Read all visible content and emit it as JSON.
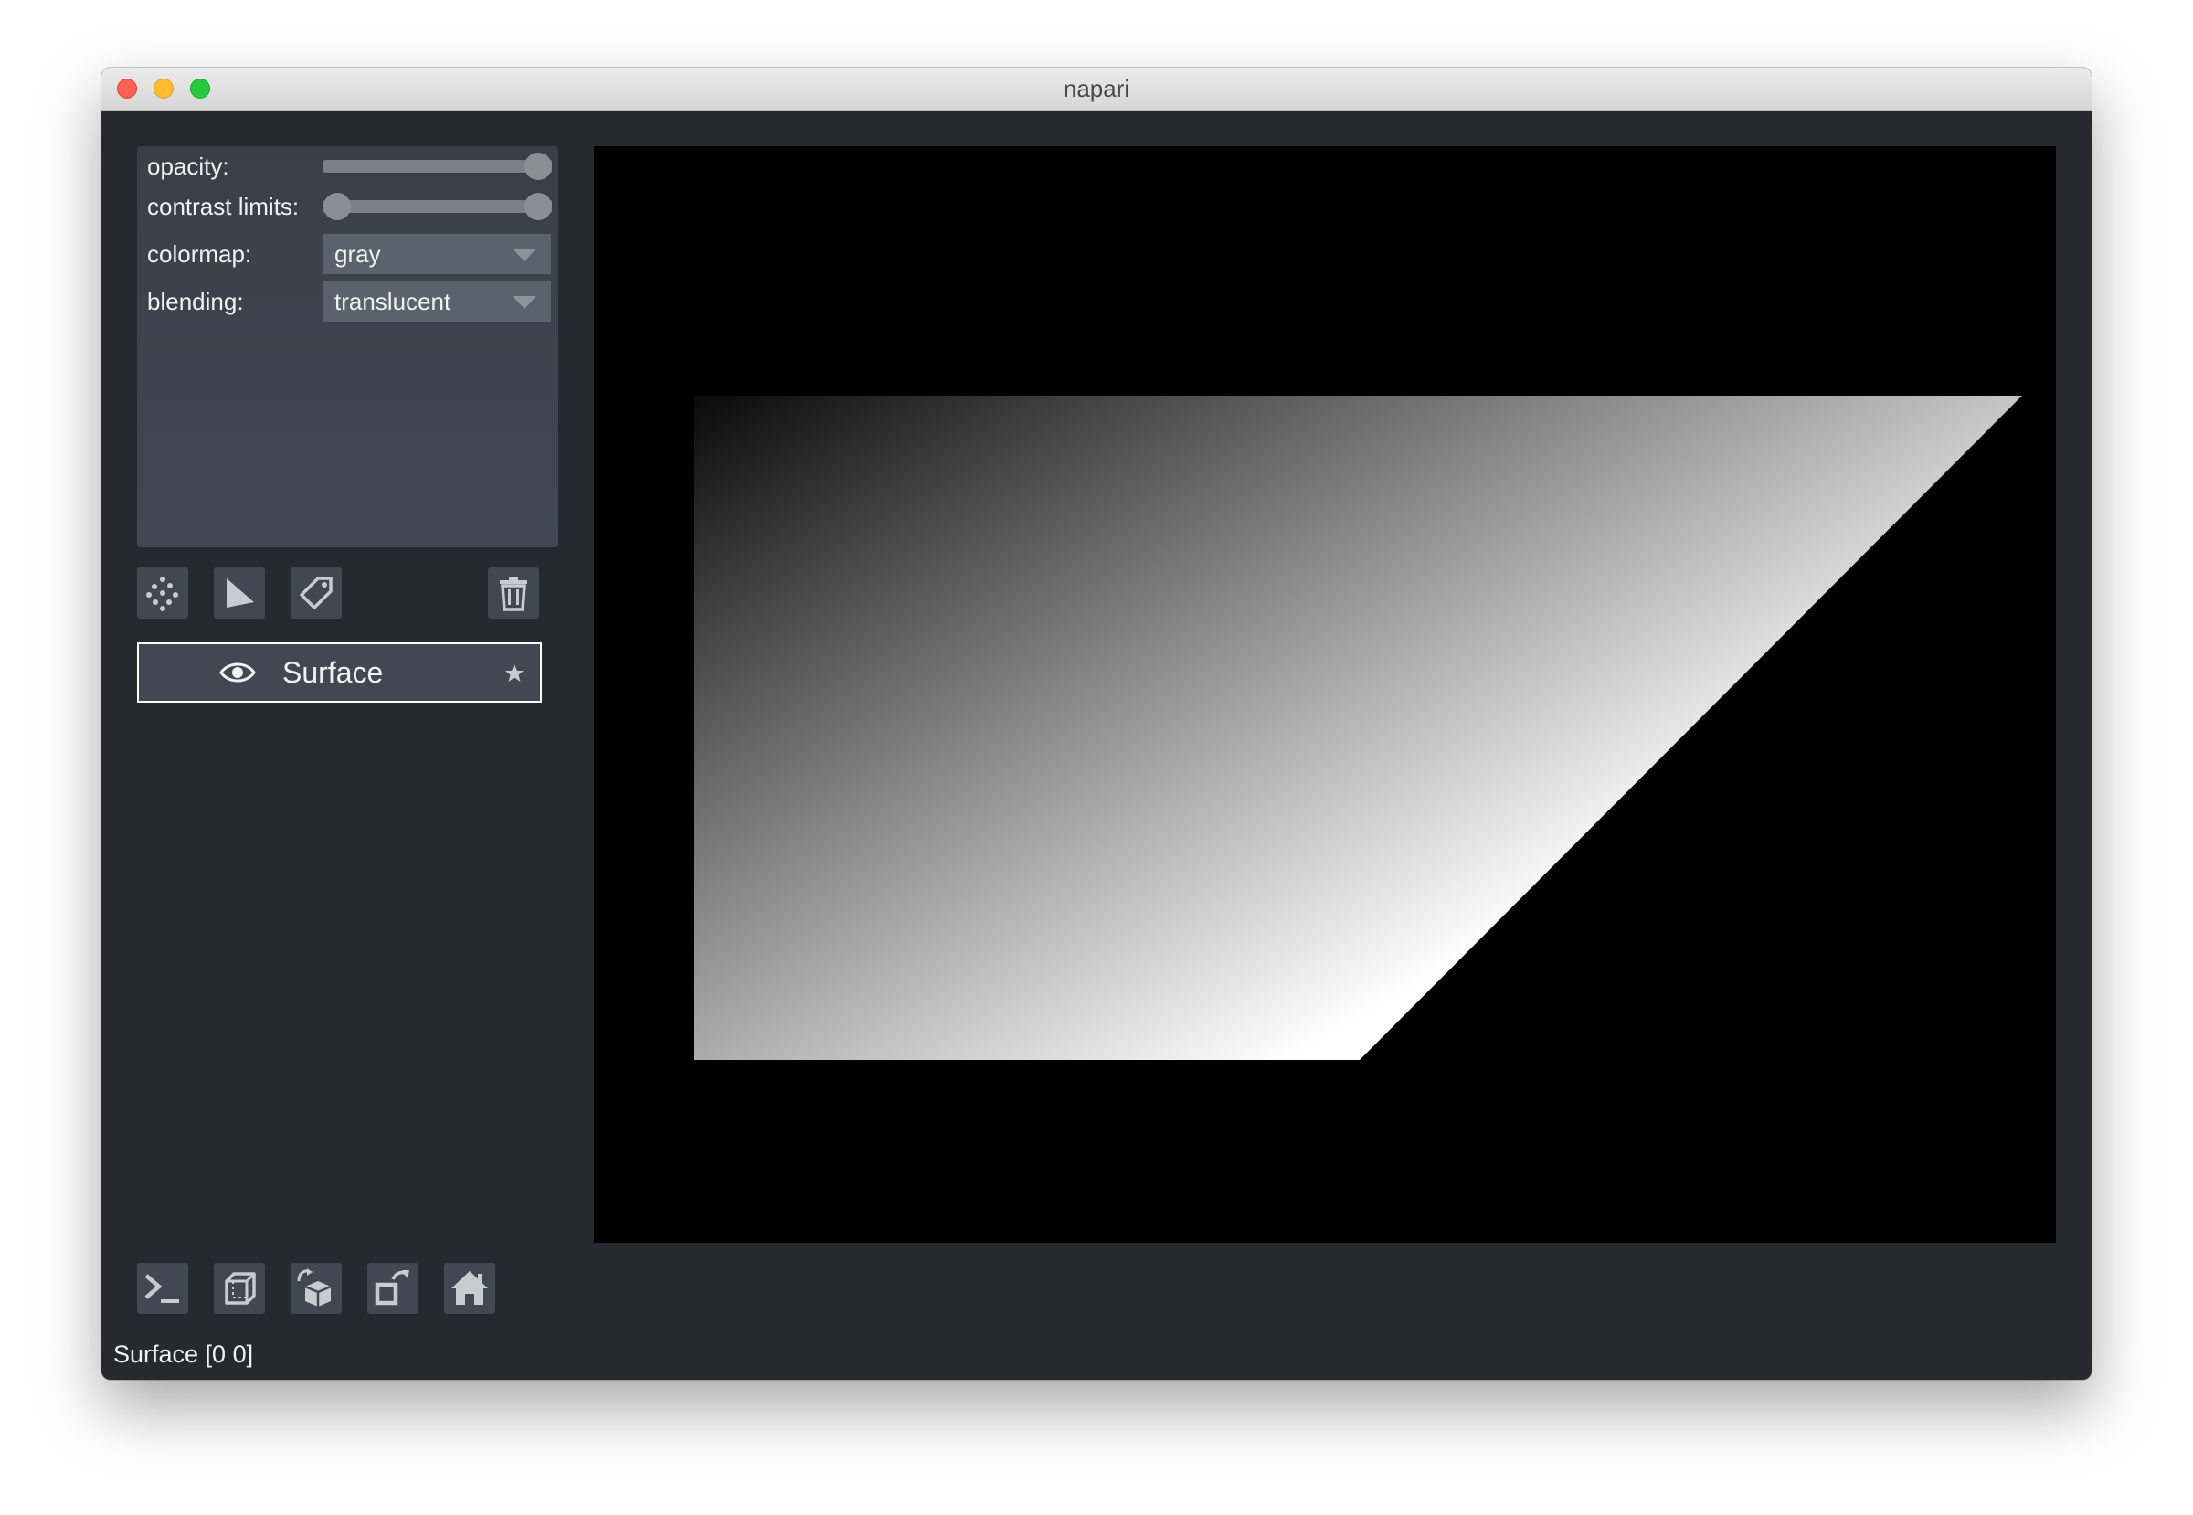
{
  "window": {
    "title": "napari"
  },
  "layer_controls": {
    "opacity": {
      "label": "opacity:",
      "value": 1.0
    },
    "contrast_limits": {
      "label": "contrast limits:",
      "low": 0.0,
      "high": 1.0
    },
    "colormap": {
      "label": "colormap:",
      "value": "gray"
    },
    "blending": {
      "label": "blending:",
      "value": "translucent"
    }
  },
  "layer_buttons": [
    "new-points-icon",
    "new-shapes-icon",
    "new-labels-icon",
    "delete-layer-icon"
  ],
  "layers": [
    {
      "name": "Surface",
      "visible": true,
      "selected": true
    }
  ],
  "viewer_buttons": [
    "console-icon",
    "ndisplay-icon",
    "roll-dims-icon",
    "transpose-dims-icon",
    "home-icon"
  ],
  "status": {
    "text": "Surface [0 0]"
  },
  "colors": {
    "background": "#262930",
    "panel": "#414851",
    "canvas": "#000000",
    "text": "#f0f1f2"
  }
}
